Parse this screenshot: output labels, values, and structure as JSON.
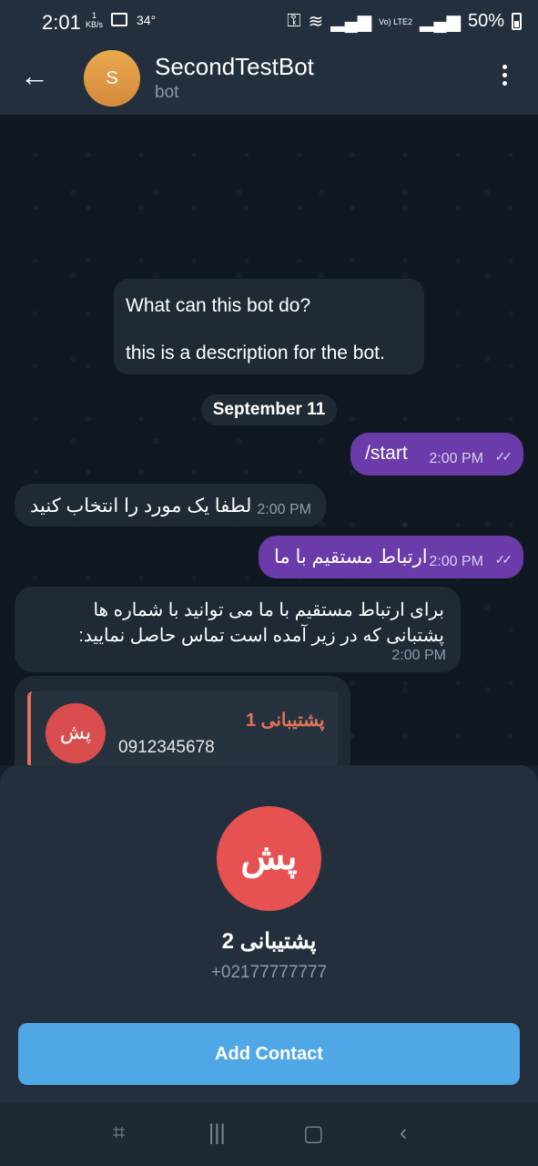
{
  "status": {
    "time": "2:01",
    "kbs": "1",
    "kbs_unit": "KB/s",
    "temp": "34°",
    "network": "Vo) LTE2",
    "battery": "50%"
  },
  "header": {
    "back_icon": "arrow-left-icon",
    "avatar_letter": "S",
    "title": "SecondTestBot",
    "subtitle": "bot",
    "menu_icon": "more-vertical-icon"
  },
  "chat": {
    "info_title": "What can this bot do?",
    "info_body": "this is a description for the bot.",
    "date": "September 11",
    "messages": [
      {
        "direction": "out",
        "text": "/start",
        "time": "2:00 PM",
        "read": "✓✓"
      },
      {
        "direction": "in",
        "text": "لطفا یک مورد را انتخاب کنید",
        "time": "2:00 PM"
      },
      {
        "direction": "out",
        "text": "ارتباط مستقیم با ما",
        "time": "2:00 PM",
        "read": "✓✓"
      },
      {
        "direction": "in",
        "text": "برای ارتباط مستقیم با ما می توانید با شماره ها پشتبانی که در زیر آمده است تماس حاصل نمایید:",
        "time": "2:00 PM"
      }
    ],
    "contact_preview": {
      "avatar": "پش",
      "name": "پشتیبانی 1",
      "phone": "0912345678"
    }
  },
  "sheet": {
    "avatar": "پش",
    "name": "پشتیبانی 2",
    "phone": "+02177777777",
    "button": "Add Contact"
  },
  "nav": {
    "screenshot_icon": "screenshot-icon",
    "recent_icon": "recent-apps-icon",
    "home_icon": "home-icon",
    "back_icon": "back-icon"
  },
  "colors": {
    "header": "#242f3d",
    "outgoing": "#6b3ba9",
    "incoming": "#1f2a35",
    "accent": "#4fa7e5"
  }
}
